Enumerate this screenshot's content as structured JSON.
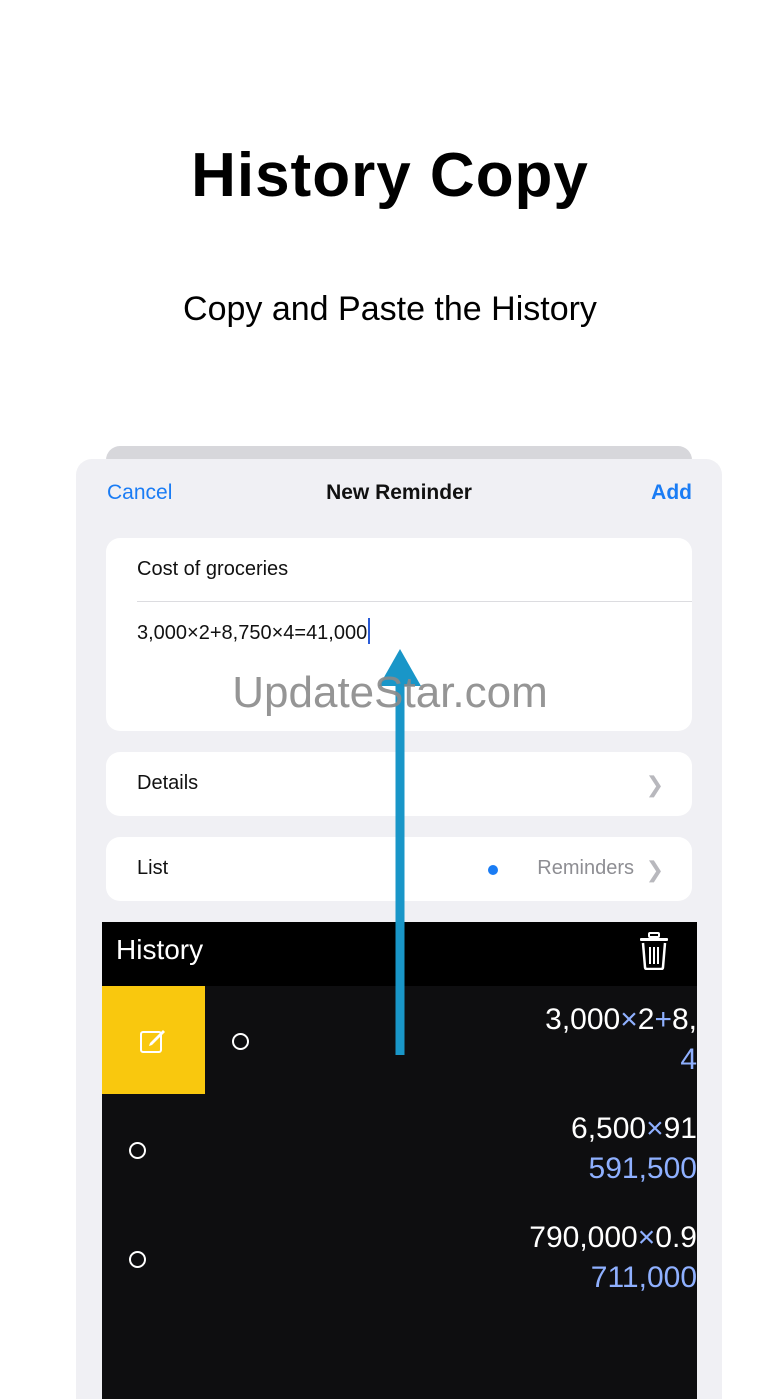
{
  "promo": {
    "headline": "History Copy",
    "subline": "Copy and Paste the History"
  },
  "reminder_sheet": {
    "cancel_label": "Cancel",
    "title": "New Reminder",
    "add_label": "Add",
    "title_field_value": "Cost of groceries",
    "notes_field_value": "3,000×2+8,750×4=41,000",
    "details_label": "Details",
    "list_label": "List",
    "list_value": "Reminders",
    "accent_color": "#1a7cf4"
  },
  "history": {
    "title": "History",
    "rows": [
      {
        "expr_a": "3,000",
        "op1": "×",
        "expr_b": "2",
        "op2": "+",
        "expr_c": "8,",
        "result": "4"
      },
      {
        "expr_a": "6,500",
        "op1": "×",
        "expr_b": "91",
        "result": "591,500"
      },
      {
        "expr_a": "790,000",
        "op1": "×",
        "expr_b": "0.9",
        "result": "711,000"
      }
    ],
    "icons": [
      "trash-icon",
      "edit-icon"
    ],
    "edit_color": "#f9c80e",
    "result_color": "#8fb0ff"
  },
  "watermark": "UpdateStar.com"
}
